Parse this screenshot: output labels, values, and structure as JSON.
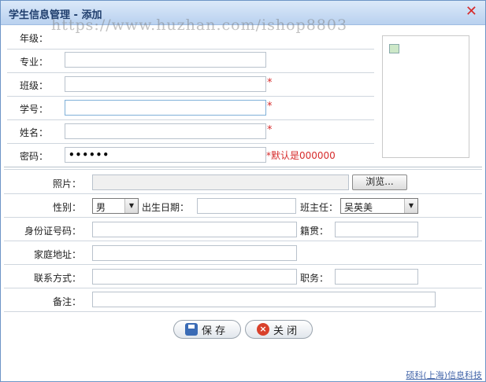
{
  "window": {
    "title": "学生信息管理 - 添加",
    "close_glyph": "✕"
  },
  "watermark": "https://www.huzhan.com/ishop8803",
  "top_form": {
    "grade_label": "年级：",
    "major_label": "专业：",
    "class_label": "班级：",
    "student_id_label": "学号：",
    "name_label": "姓名：",
    "password_label": "密码：",
    "password_value": "••••••",
    "required_mark": "*",
    "password_hint": "*默认是000000"
  },
  "bottom_form": {
    "photo_label": "照片：",
    "browse_button": "浏览...",
    "gender_label": "性别：",
    "gender_value": "男",
    "birthdate_label": "出生日期：",
    "head_teacher_label": "班主任：",
    "head_teacher_value": "吴英美",
    "id_card_label": "身份证号码：",
    "native_place_label": "籍贯：",
    "address_label": "家庭地址：",
    "contact_label": "联系方式：",
    "position_label": "职务：",
    "remark_label": "备注："
  },
  "buttons": {
    "save": "保 存",
    "close": "关 闭"
  },
  "footer": "硕科(上海)信息科技"
}
